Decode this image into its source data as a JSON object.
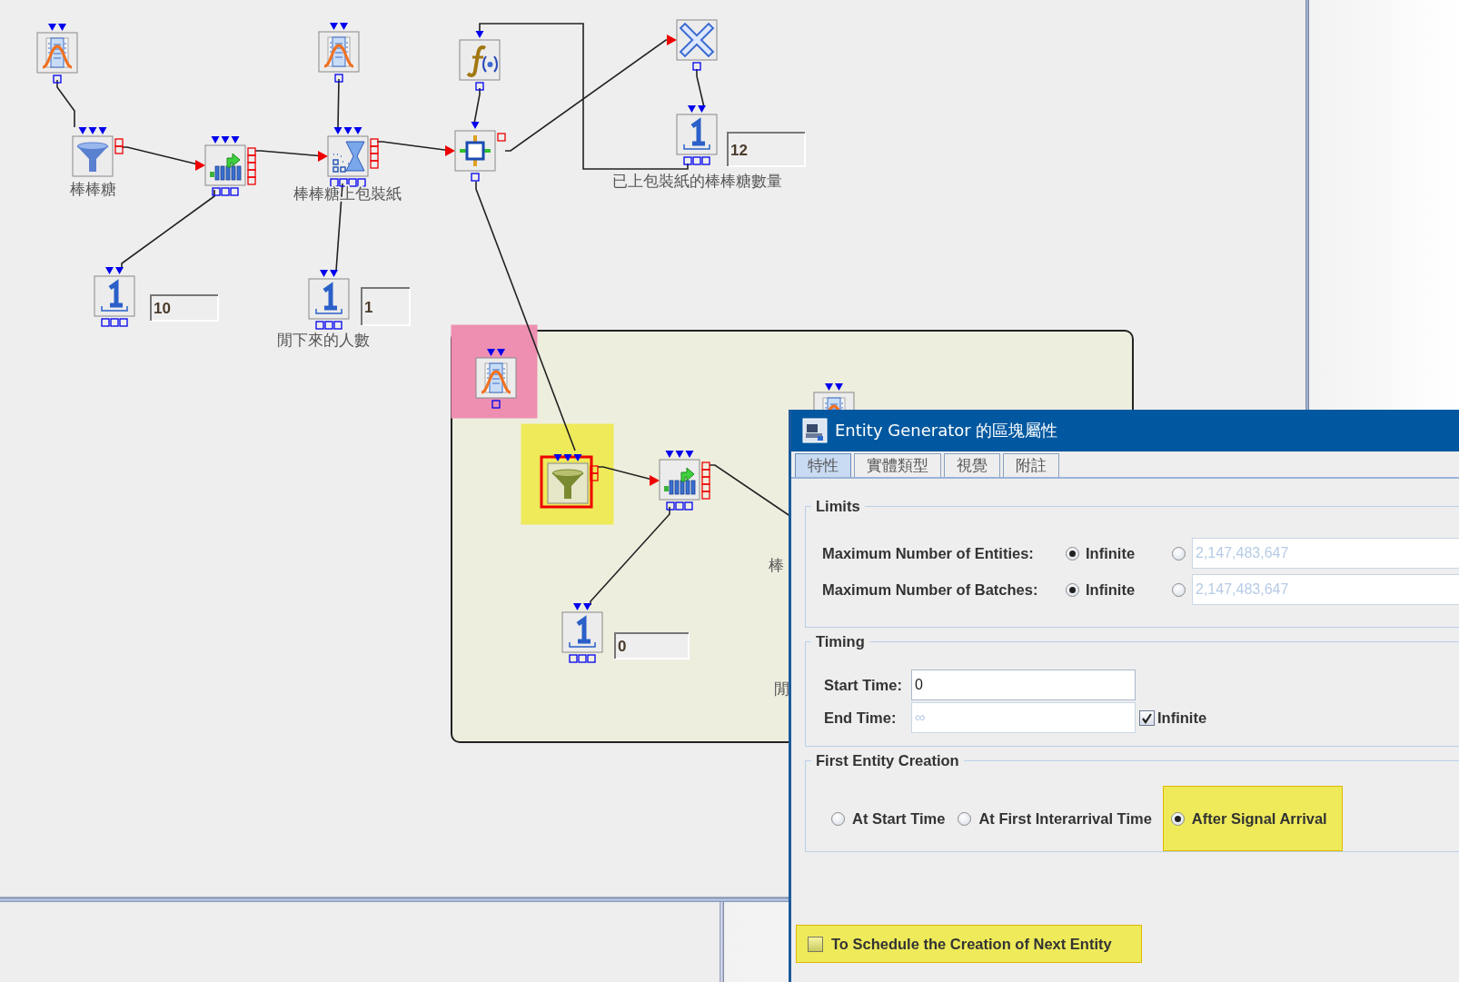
{
  "diagram": {
    "blocks": [
      {
        "kind": "random_source",
        "selected": false
      },
      {
        "kind": "funnel",
        "label": "棒棒糖",
        "selected": false
      },
      {
        "kind": "queue",
        "selected": false
      },
      {
        "kind": "server",
        "label": "棒棒糖上包裝紙",
        "selected": false
      },
      {
        "kind": "random_source",
        "selected": false
      },
      {
        "kind": "function",
        "selected": false
      },
      {
        "kind": "combiner",
        "selected": false
      },
      {
        "kind": "sink",
        "selected": false
      },
      {
        "kind": "counter",
        "value": "12",
        "label": "已上包裝紙的棒棒糖數量",
        "selected": false
      },
      {
        "kind": "counter",
        "value": "10",
        "selected": false
      },
      {
        "kind": "counter",
        "value": "1",
        "label": "閒下來的人數",
        "selected": false
      },
      {
        "kind": "random_source",
        "selected": false,
        "color": "#ee8fb1"
      },
      {
        "kind": "funnel",
        "selected": true,
        "color": "#eeea5a"
      },
      {
        "kind": "queue",
        "selected": false
      },
      {
        "kind": "counter",
        "value": "0",
        "selected": false
      },
      {
        "kind": "random_source",
        "selected": false
      }
    ],
    "partial_labels": [
      "棒",
      "閒"
    ]
  },
  "dialog": {
    "title": "Entity Generator 的區塊屬性",
    "tabs": [
      {
        "label": "特性",
        "selected": true
      },
      {
        "label": "實體類型",
        "selected": false
      },
      {
        "label": "視覺",
        "selected": false
      },
      {
        "label": "附註",
        "selected": false
      }
    ],
    "limits": {
      "title": "Limits",
      "rows": [
        {
          "label": "Maximum Number of Entities:",
          "infinite": {
            "label": "Infinite",
            "selected": true
          },
          "custom": {
            "selected": false,
            "value": "2,147,483,647",
            "disabled": true
          }
        },
        {
          "label": "Maximum Number of Batches:",
          "infinite": {
            "label": "Infinite",
            "selected": true
          },
          "custom": {
            "selected": false,
            "value": "2,147,483,647",
            "disabled": true
          }
        }
      ]
    },
    "timing": {
      "title": "Timing",
      "start_time": {
        "label": "Start Time:",
        "value": "0",
        "disabled": false
      },
      "end_time": {
        "label": "End Time:",
        "value": "∞",
        "disabled": true
      },
      "infinite": {
        "label": "Infinite",
        "checked": true
      }
    },
    "first_entity_creation": {
      "title": "First Entity Creation",
      "options": [
        {
          "label": "At Start Time",
          "selected": false,
          "highlighted": false
        },
        {
          "label": "At First Interarrival Time",
          "selected": false,
          "highlighted": false
        },
        {
          "label": "After Signal Arrival",
          "selected": true,
          "highlighted": true
        }
      ]
    },
    "schedule_next": {
      "label": "To Schedule the Creation of Next Entity",
      "checked": false,
      "highlighted": true
    }
  }
}
